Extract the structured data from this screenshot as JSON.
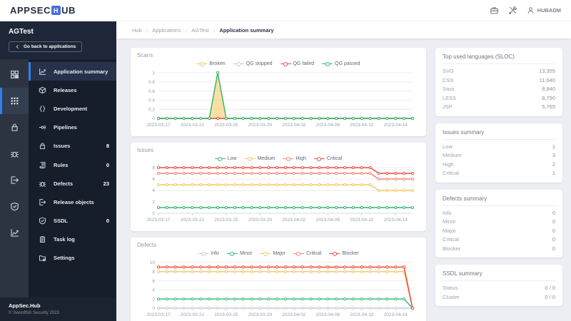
{
  "topbar": {
    "logo_prefix": "APPSEC",
    "logo_letter": "H",
    "logo_suffix": "UB",
    "user": "HUBADM",
    "icons": [
      "briefcase-icon",
      "tools-icon",
      "user-icon"
    ]
  },
  "breadcrumb": {
    "separator": "›",
    "items": [
      "Hub",
      "Applications",
      "AGTest",
      "Application summary"
    ]
  },
  "sidebar": {
    "app_name": "AGTest",
    "back_button": "Go back to applications",
    "rail": [
      {
        "icon": "dashboard-icon",
        "active": false
      },
      {
        "icon": "apps-grid-icon",
        "active": true
      },
      {
        "icon": "lock-icon",
        "active": false
      },
      {
        "icon": "bug-icon",
        "active": false
      },
      {
        "icon": "exit-icon",
        "active": false
      },
      {
        "icon": "shield-check-icon",
        "active": false
      },
      {
        "icon": "chart-line-icon",
        "active": false
      }
    ],
    "menu": [
      {
        "label": "Application summary",
        "icon": "chart-line-icon",
        "active": true
      },
      {
        "label": "Releases",
        "icon": "package-icon"
      },
      {
        "label": "Development",
        "icon": "code-braces-icon"
      },
      {
        "label": "Pipelines",
        "icon": "pipeline-icon"
      },
      {
        "label": "Issues",
        "icon": "lock-icon",
        "badge": "8"
      },
      {
        "label": "Rules",
        "icon": "scroll-icon",
        "badge": "0"
      },
      {
        "label": "Defects",
        "icon": "bug-icon",
        "badge": "23"
      },
      {
        "label": "Release objects",
        "icon": "exit-icon"
      },
      {
        "label": "SSDL",
        "icon": "shield-check-icon",
        "badge": "0"
      },
      {
        "label": "Task log",
        "icon": "clipboard-icon"
      },
      {
        "label": "Settings",
        "icon": "folder-gear-icon"
      }
    ],
    "footer": {
      "title": "AppSec.Hub",
      "copyright": "© Swordfish Security 2023"
    }
  },
  "colors": {
    "accent_blue": "#2f80ed",
    "logo_blue": "#4a6fdc",
    "green": "#2eb86f",
    "yellow": "#f6c75f",
    "salmon": "#f3867c",
    "red": "#ee4b40",
    "gray": "#c9ccd4",
    "sidebar_bg": "#161e2b",
    "rail_bg": "#2c3441",
    "page_bg": "#eceef3"
  },
  "summary_cards": [
    {
      "title": "Top used languages (SLOC)",
      "rows": [
        {
          "name": "SVG",
          "value": "13,355"
        },
        {
          "name": "CSS",
          "value": "11,640"
        },
        {
          "name": "Sass",
          "value": "8,840"
        },
        {
          "name": "LESS",
          "value": "8,790"
        },
        {
          "name": "JSP",
          "value": "5,765"
        }
      ]
    },
    {
      "title": "Issues summary",
      "rows": [
        {
          "name": "Low",
          "value": "1"
        },
        {
          "name": "Medium",
          "value": "3"
        },
        {
          "name": "High",
          "value": "2"
        },
        {
          "name": "Critical",
          "value": "1"
        }
      ]
    },
    {
      "title": "Defects summary",
      "rows": [
        {
          "name": "Info",
          "value": "0"
        },
        {
          "name": "Minor",
          "value": "0"
        },
        {
          "name": "Major",
          "value": "0"
        },
        {
          "name": "Critical",
          "value": "0"
        },
        {
          "name": "Blocker",
          "value": "0"
        }
      ]
    },
    {
      "title": "SSDL summary",
      "rows": [
        {
          "name": "Status",
          "value": "0 / 0"
        },
        {
          "name": "Cluster",
          "value": "0 / 0"
        }
      ]
    }
  ],
  "chart_data": [
    {
      "type": "line",
      "title": "Scans",
      "xlabel": "",
      "ylabel": "",
      "legend_position": "top",
      "grid": true,
      "ylim": [
        0,
        1
      ],
      "yticks": [
        0,
        0.2,
        0.4,
        0.6,
        0.8,
        1
      ],
      "ytick_labels": [
        "0",
        "0.2",
        "0.4",
        "0.6",
        "0.8",
        "1"
      ],
      "xtick_every": 4,
      "x": [
        "2023-03-17",
        "2023-03-18",
        "2023-03-19",
        "2023-03-20",
        "2023-03-21",
        "2023-03-22",
        "2023-03-23",
        "2023-03-24",
        "2023-03-25",
        "2023-03-26",
        "2023-03-27",
        "2023-03-28",
        "2023-03-29",
        "2023-03-30",
        "2023-03-31",
        "2023-04-01",
        "2023-04-02",
        "2023-04-03",
        "2023-04-04",
        "2023-04-05",
        "2023-04-06",
        "2023-04-07",
        "2023-04-08",
        "2023-04-09",
        "2023-04-10",
        "2023-04-11",
        "2023-04-12",
        "2023-04-13",
        "2023-04-14",
        "2023-04-15",
        "2023-04-16"
      ],
      "series": [
        {
          "name": "Broken",
          "color": "#f6c75f",
          "area": true,
          "values": [
            0,
            0,
            0,
            0,
            0,
            0,
            0,
            1,
            0,
            0,
            0,
            0,
            0,
            0,
            0,
            0,
            0,
            0,
            0,
            0,
            0,
            0,
            0,
            0,
            0,
            0,
            0,
            0,
            0,
            0,
            0
          ]
        },
        {
          "name": "QG skipped",
          "color": "#c9ccd4",
          "area": false,
          "values": [
            0,
            0,
            0,
            0,
            0,
            0,
            0,
            0,
            0,
            0,
            0,
            0,
            0,
            0,
            0,
            0,
            0,
            0,
            0,
            0,
            0,
            0,
            0,
            0,
            0,
            0,
            0,
            0,
            0,
            0,
            0
          ]
        },
        {
          "name": "QG failed",
          "color": "#ee4b40",
          "area": false,
          "values": [
            0,
            0,
            0,
            0,
            0,
            0,
            0,
            0,
            0,
            0,
            0,
            0,
            0,
            0,
            0,
            0,
            0,
            0,
            0,
            0,
            0,
            0,
            0,
            0,
            0,
            0,
            0,
            0,
            0,
            0,
            0
          ]
        },
        {
          "name": "QG passed",
          "color": "#2eb86f",
          "area": false,
          "values": [
            0,
            0,
            0,
            0,
            0,
            0,
            0,
            1,
            0,
            0,
            0,
            0,
            0,
            0,
            0,
            0,
            0,
            0,
            0,
            0,
            0,
            0,
            0,
            0,
            0,
            0,
            0,
            0,
            0,
            0,
            0
          ]
        }
      ]
    },
    {
      "type": "line",
      "title": "Issues",
      "xlabel": "",
      "ylabel": "",
      "legend_position": "top",
      "grid": true,
      "ylim": [
        0,
        8
      ],
      "yticks": [
        0,
        2,
        4,
        6,
        8
      ],
      "ytick_labels": [
        "0",
        "2",
        "4",
        "6",
        "8"
      ],
      "xtick_every": 4,
      "x": [
        "2023-03-17",
        "2023-03-18",
        "2023-03-19",
        "2023-03-20",
        "2023-03-21",
        "2023-03-22",
        "2023-03-23",
        "2023-03-24",
        "2023-03-25",
        "2023-03-26",
        "2023-03-27",
        "2023-03-28",
        "2023-03-29",
        "2023-03-30",
        "2023-03-31",
        "2023-04-01",
        "2023-04-02",
        "2023-04-03",
        "2023-04-04",
        "2023-04-05",
        "2023-04-06",
        "2023-04-07",
        "2023-04-08",
        "2023-04-09",
        "2023-04-10",
        "2023-04-11",
        "2023-04-12",
        "2023-04-13",
        "2023-04-14",
        "2023-04-15",
        "2023-04-16"
      ],
      "series": [
        {
          "name": "Low",
          "color": "#2eb86f",
          "area": false,
          "values": [
            1,
            1,
            1,
            1,
            1,
            1,
            1,
            1,
            1,
            1,
            1,
            1,
            1,
            1,
            1,
            1,
            1,
            1,
            1,
            1,
            1,
            1,
            1,
            1,
            1,
            1,
            1,
            1,
            1,
            1,
            1
          ]
        },
        {
          "name": "Medium",
          "color": "#f6c75f",
          "area": false,
          "values": [
            5,
            5,
            5,
            5,
            5,
            5,
            5,
            5,
            5,
            5,
            5,
            5,
            5,
            5,
            5,
            5,
            5,
            5,
            5,
            5,
            5,
            5,
            5,
            5,
            5,
            5,
            4,
            4,
            4,
            4,
            4
          ]
        },
        {
          "name": "High",
          "color": "#f3867c",
          "area": false,
          "values": [
            7,
            7,
            7,
            7,
            7,
            7,
            7,
            7,
            7,
            7,
            7,
            7,
            7,
            7,
            7,
            7,
            7,
            7,
            7,
            7,
            7,
            7,
            7,
            7,
            7,
            7,
            6,
            6,
            6,
            6,
            6
          ]
        },
        {
          "name": "Critical",
          "color": "#ee4b40",
          "area": false,
          "values": [
            8,
            8,
            8,
            8,
            8,
            8,
            8,
            8,
            8,
            8,
            8,
            8,
            8,
            8,
            8,
            8,
            8,
            8,
            8,
            8,
            8,
            8,
            8,
            8,
            8,
            8,
            7,
            7,
            7,
            7,
            7
          ]
        }
      ]
    },
    {
      "type": "line",
      "title": "Defects",
      "xlabel": "",
      "ylabel": "",
      "legend_position": "top",
      "grid": true,
      "ylim": [
        0,
        10
      ],
      "yticks": [
        0,
        2,
        4,
        6,
        8,
        10
      ],
      "ytick_labels": [
        "0",
        "2",
        "4",
        "6",
        "8",
        "10"
      ],
      "xtick_every": 4,
      "x": [
        "2023-03-17",
        "2023-03-18",
        "2023-03-19",
        "2023-03-20",
        "2023-03-21",
        "2023-03-22",
        "2023-03-23",
        "2023-03-24",
        "2023-03-25",
        "2023-03-26",
        "2023-03-27",
        "2023-03-28",
        "2023-03-29",
        "2023-03-30",
        "2023-03-31",
        "2023-04-01",
        "2023-04-02",
        "2023-04-03",
        "2023-04-04",
        "2023-04-05",
        "2023-04-06",
        "2023-04-07",
        "2023-04-08",
        "2023-04-09",
        "2023-04-10",
        "2023-04-11",
        "2023-04-12",
        "2023-04-13",
        "2023-04-14",
        "2023-04-15",
        "2023-04-16"
      ],
      "series": [
        {
          "name": "Info",
          "color": "#c9ccd4",
          "area": false,
          "values": [
            0,
            0,
            0,
            0,
            0,
            0,
            0,
            0,
            0,
            0,
            0,
            0,
            0,
            0,
            0,
            0,
            0,
            0,
            0,
            0,
            0,
            0,
            0,
            0,
            0,
            0,
            0,
            0,
            0,
            0,
            0
          ]
        },
        {
          "name": "Minor",
          "color": "#2eb86f",
          "area": false,
          "values": [
            2,
            2,
            2,
            2,
            2,
            2,
            2,
            2,
            2,
            2,
            2,
            2,
            2,
            2,
            2,
            2,
            2,
            2,
            2,
            2,
            2,
            2,
            2,
            2,
            2,
            2,
            2,
            2,
            2,
            2,
            0
          ]
        },
        {
          "name": "Major",
          "color": "#f6c75f",
          "area": false,
          "values": [
            8,
            8,
            8,
            8,
            8,
            8,
            8,
            8,
            8,
            8,
            8,
            8,
            8,
            8,
            8,
            8,
            8,
            8,
            8,
            8,
            8,
            8,
            8,
            8,
            8,
            8,
            8,
            8,
            8,
            8,
            0
          ]
        },
        {
          "name": "Critical",
          "color": "#f3867c",
          "area": false,
          "values": [
            9,
            9,
            9,
            9,
            9,
            9,
            9,
            9,
            9,
            9,
            9,
            9,
            9,
            9,
            9,
            9,
            9,
            9,
            9,
            9,
            9,
            9,
            9,
            9,
            9,
            9,
            9,
            9,
            9,
            9,
            0
          ]
        },
        {
          "name": "Blocker",
          "color": "#ee4b40",
          "area": false,
          "values": [
            9,
            9,
            9,
            9,
            9,
            9,
            9,
            9,
            9,
            9,
            9,
            9,
            9,
            9,
            9,
            9,
            9,
            9,
            9,
            9,
            9,
            9,
            9,
            9,
            9,
            9,
            9,
            9,
            9,
            9,
            0
          ]
        }
      ]
    }
  ]
}
